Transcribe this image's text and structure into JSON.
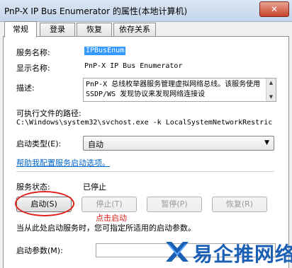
{
  "window": {
    "title": "PnP-X IP Bus Enumerator 的属性(本地计算机)",
    "close_label": "✕"
  },
  "tabs": [
    {
      "label": "常规"
    },
    {
      "label": "登录"
    },
    {
      "label": "恢复"
    },
    {
      "label": "依存关系"
    }
  ],
  "general": {
    "service_name_label": "服务名称:",
    "service_name": "IPBusEnum",
    "display_name_label": "显示名称:",
    "display_name": "PnP-X IP Bus Enumerator",
    "description_label": "描述:",
    "description": "PnP-X 总线枚举器服务管理虚拟网络总线。该服务使用 SSDP/WS 发现协议来发现网络连接设",
    "path_label": "可执行文件的路径:",
    "path": "C:\\Windows\\system32\\svchost.exe -k LocalSystemNetworkRestric",
    "startup_type_label": "启动类型(E):",
    "startup_type_value": "自动",
    "help_link": "帮助我配置服务启动选项。",
    "status_label": "服务状态:",
    "status_value": "已停止",
    "buttons": {
      "start": "启动(S)",
      "stop": "停止(T)",
      "pause": "暂停(P)",
      "resume": "恢复(R)"
    },
    "annotation": "点击启动",
    "hint": "当从此处启动服务时，您可指定所适用的启动参数。",
    "params_label": "启动参数(M):",
    "params_value": ""
  },
  "watermark": {
    "text": "易企推网络"
  },
  "colors": {
    "accent": "#3399ff",
    "link": "#0066cc",
    "annotation": "#e0201a",
    "watermark": "#1a5fb4"
  }
}
